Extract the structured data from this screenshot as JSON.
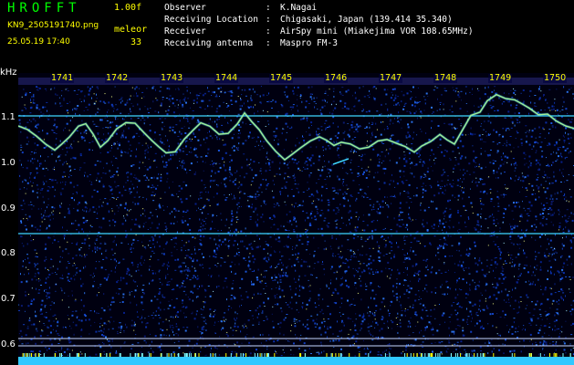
{
  "header": {
    "app_title": "HROFFT",
    "version": "1.00f",
    "filename": "KN9_2505191740.png",
    "mode": "meleor",
    "datetime": "25.05.19 17:40",
    "count": "33"
  },
  "info": [
    {
      "key": "Observer",
      "value": "K.Nagai"
    },
    {
      "key": "Receiving Location",
      "value": "Chigasaki, Japan (139.414 35.340)"
    },
    {
      "key": "Receiver",
      "value": "AirSpy mini (Miakejima VOR 108.65MHz)"
    },
    {
      "key": "Receiving antenna",
      "value": "Maspro FM-3"
    }
  ],
  "info_separator": ":",
  "y_axis": {
    "unit": "kHz",
    "ticks": [
      "1.1",
      "1.0",
      "0.9",
      "0.8",
      "0.7",
      "0.6"
    ]
  },
  "x_axis": {
    "minutes": [
      "1741",
      "1742",
      "1743",
      "1744",
      "1745",
      "1746",
      "1747",
      "1748",
      "1749",
      "1750"
    ]
  },
  "colors": {
    "background": "#000000",
    "noise_blue": "#0a2a90",
    "trace": "#d8ff60",
    "carrier_line": "#3fd8ff",
    "label_yellow": "#ffff00",
    "title_green": "#00ff00",
    "text_white": "#ffffff"
  }
}
